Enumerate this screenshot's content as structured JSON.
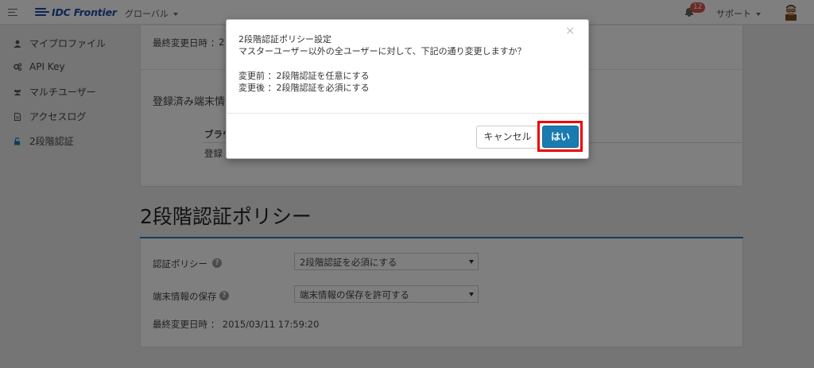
{
  "header": {
    "logo_text": "IDC Frontier",
    "nav_global": "グローバル",
    "notification_count": "12",
    "support_label": "サポート"
  },
  "sidebar": {
    "items": [
      {
        "label": "マイプロファイル",
        "icon": "user-icon"
      },
      {
        "label": "API Key",
        "icon": "cogs-icon"
      },
      {
        "label": "マルチユーザー",
        "icon": "users-icon"
      },
      {
        "label": "アクセスログ",
        "icon": "document-icon"
      },
      {
        "label": "2段階認証",
        "icon": "unlock-icon"
      }
    ]
  },
  "top_card": {
    "last_modified_label": "最終変更日時 ：",
    "last_modified_value_partial": "2",
    "registered_devices_title": "登録済み端末情",
    "table_header_browser": "ブラウ",
    "registered_label": "登録"
  },
  "policy_section": {
    "title": "2段階認証ポリシー",
    "policy_label": "認証ポリシー",
    "policy_value": "2段階認証を必須にする",
    "device_label": "端末情報の保存",
    "device_value": "端末情報の保存を許可する",
    "last_modified": "最終変更日時 ： 2015/03/11 17:59:20"
  },
  "modal": {
    "title": "2段階認証ポリシー設定",
    "message": "マスターユーザー以外の全ユーザーに対して、下記の通り変更しますか？",
    "before": "変更前 ：2段階認証を任意にする",
    "after": "変更後 ：2段階認証を必須にする",
    "close": "×",
    "cancel_label": "キャンセル",
    "yes_label": "はい"
  },
  "colors": {
    "brand": "#1f4aa8",
    "primary_button": "#1a7bb0",
    "highlight_frame": "#ee0000",
    "section_rule": "#2a7ab0"
  }
}
